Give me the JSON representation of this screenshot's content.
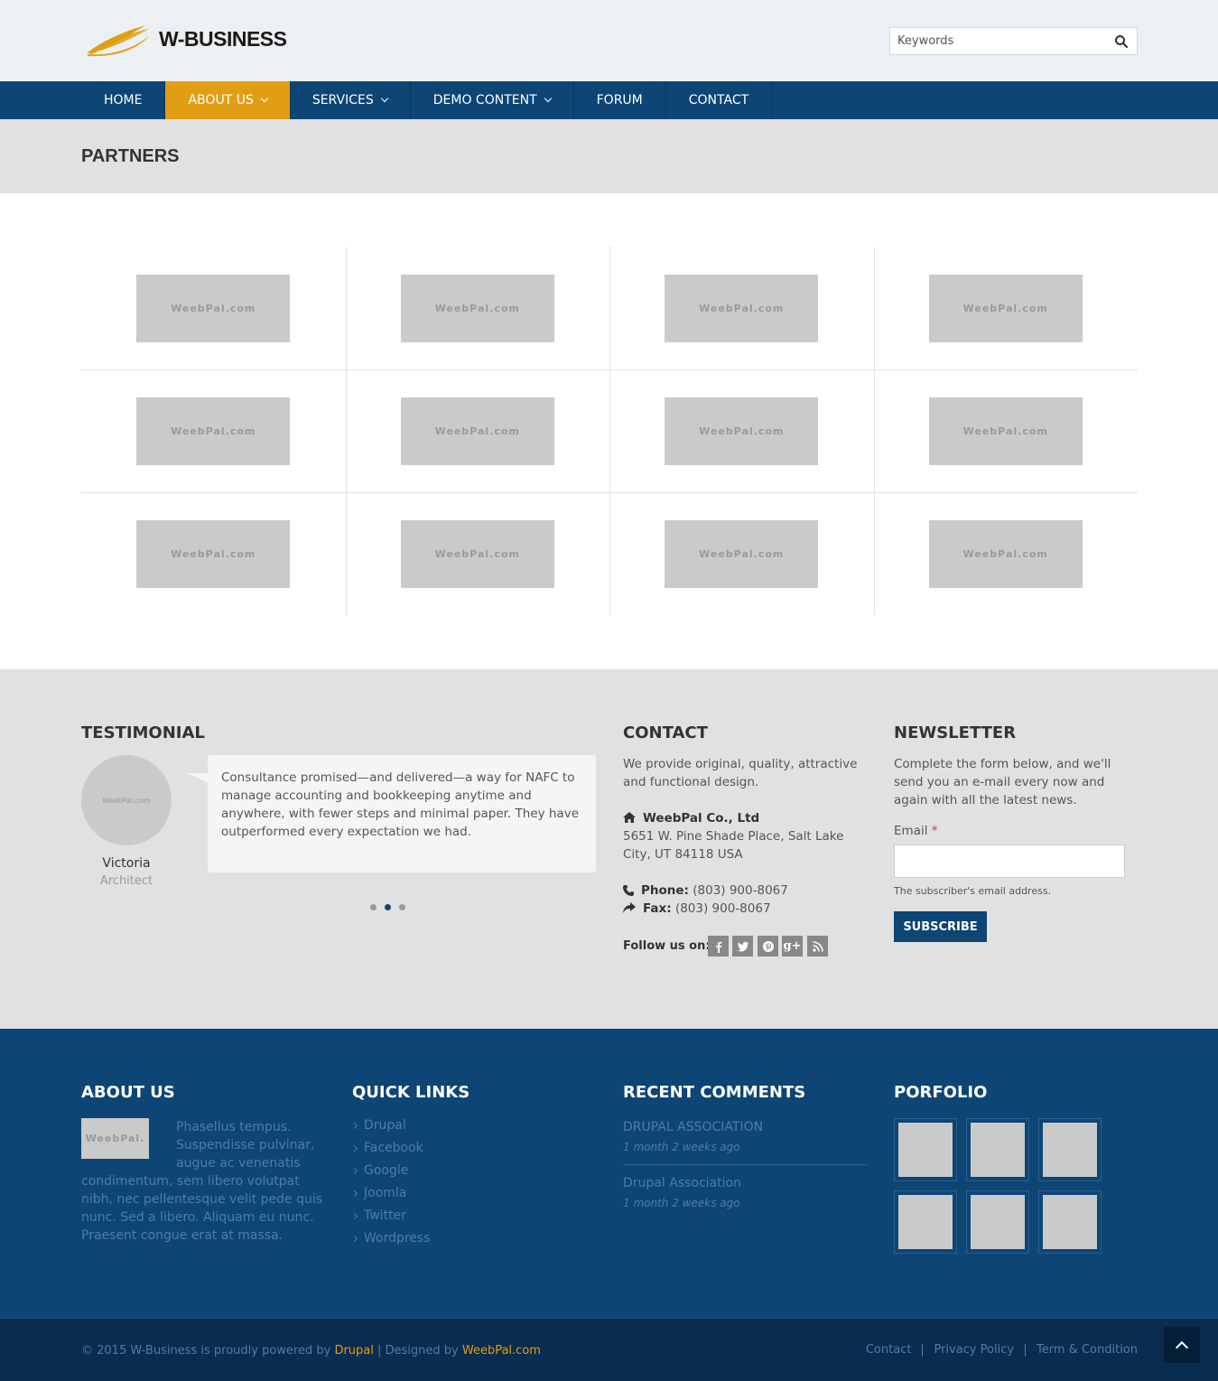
{
  "header": {
    "logo_text": "W-BUSINESS",
    "search_placeholder": "Keywords"
  },
  "nav": {
    "items": [
      {
        "label": "HOME",
        "dropdown": false,
        "active": false
      },
      {
        "label": "ABOUT US",
        "dropdown": true,
        "active": true
      },
      {
        "label": "SERVICES",
        "dropdown": true,
        "active": false
      },
      {
        "label": "DEMO CONTENT",
        "dropdown": true,
        "active": false
      },
      {
        "label": "FORUM",
        "dropdown": false,
        "active": false
      },
      {
        "label": "CONTACT",
        "dropdown": false,
        "active": false
      }
    ]
  },
  "page_title": "PARTNERS",
  "partners": {
    "logo_text": "WeebPal.com",
    "count": 12
  },
  "testimonial": {
    "heading": "TESTIMONIAL",
    "avatar_text": "WeebPal.com",
    "quote": "Consultance promised—and delivered—a way for NAFC to manage accounting and bookkeeping anytime and anywhere, with fewer steps and minimal paper. They have outperformed every expectation we had.",
    "name": "Victoria",
    "role": "Architect",
    "active_dot": 2
  },
  "contact": {
    "heading": "CONTACT",
    "intro": "We provide original, quality, attractive and functional design.",
    "company": "WeebPal Co., Ltd",
    "address": "5651 W. Pine Shade Place, Salt Lake City, UT 84118 USA",
    "phone_label": "Phone:",
    "phone": "(803) 900-8067",
    "fax_label": "Fax:",
    "fax": "(803) 900-8067",
    "follow_label": "Follow us on:",
    "social_icons": [
      "facebook-icon",
      "twitter-icon",
      "pinterest-icon",
      "google-plus-icon",
      "rss-icon"
    ]
  },
  "newsletter": {
    "heading": "NEWSLETTER",
    "intro": "Complete the form below, and we'll send you an e-mail every now and again with all the latest news.",
    "email_label": "Email",
    "required_mark": "*",
    "email_value": "",
    "help_text": "The subscriber's email address.",
    "button": "SUBSCRIBE"
  },
  "about": {
    "heading": "ABOUT US",
    "image_text": "WeebPal.",
    "text": "Phasellus tempus. Suspendisse pulvinar, augue ac venenatis condimentum, sem libero volutpat nibh, nec pellentesque velit pede quis nunc. Sed a libero. Aliquam eu nunc. Praesent congue erat at massa."
  },
  "quick_links": {
    "heading": "QUICK LINKS",
    "items": [
      "Drupal",
      "Facebook",
      "Google",
      "Joomla",
      "Twitter",
      "Wordpress"
    ]
  },
  "recent_comments": {
    "heading": "RECENT COMMENTS",
    "items": [
      {
        "title": "DRUPAL ASSOCIATION",
        "time": "1 month 2 weeks ago"
      },
      {
        "title": "Drupal Association",
        "time": "1 month 2 weeks ago"
      }
    ]
  },
  "portfolio": {
    "heading": "PORFOLIO",
    "count": 6
  },
  "bottom": {
    "copyright_prefix": "© 2015 W-Business is proudly powered by ",
    "drupal": "Drupal",
    "separator": " | Designed by ",
    "weebpal": "WeebPal.com",
    "links": [
      "Contact",
      "Privacy Policy",
      "Term & Condition"
    ]
  },
  "colors": {
    "brand_blue": "#0d4575",
    "accent_orange": "#e19e14"
  }
}
